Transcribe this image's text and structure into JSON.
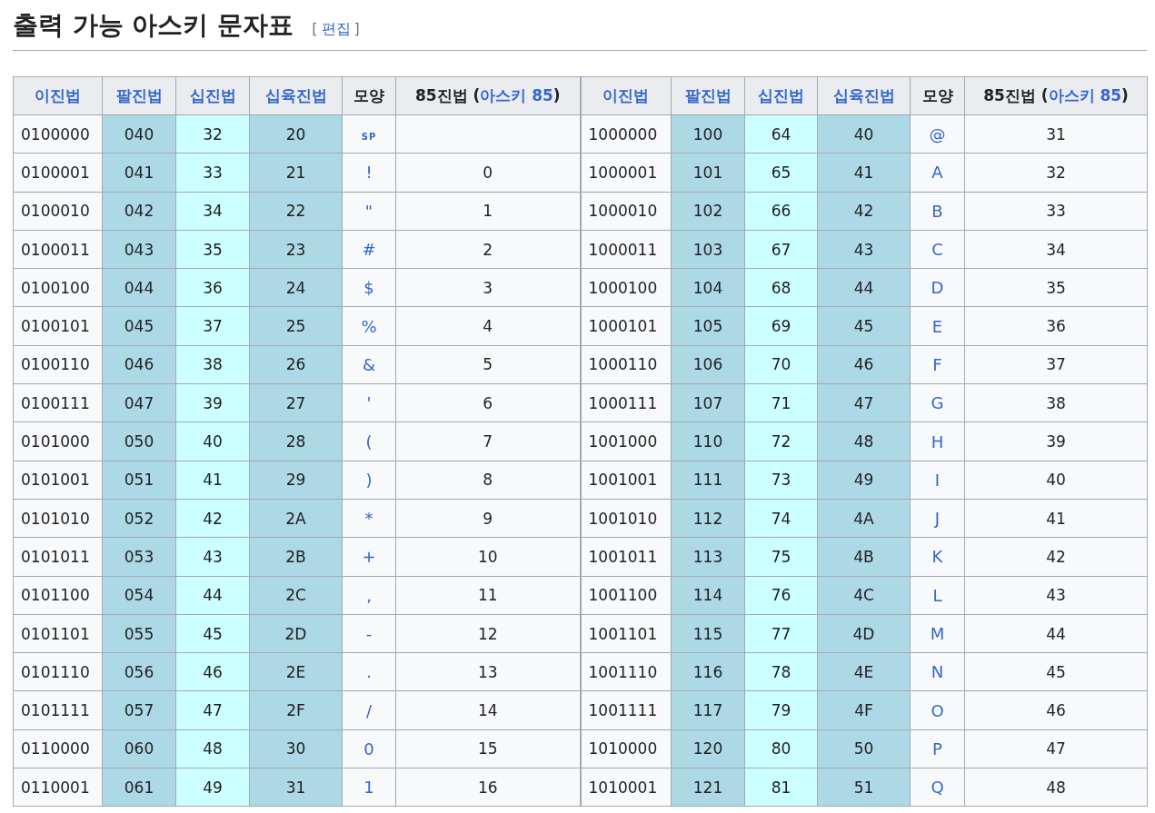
{
  "heading": {
    "title": "출력 가능 아스키 문자표",
    "edit": {
      "open": "[",
      "label": "편집",
      "close": "]"
    }
  },
  "table": {
    "columns": [
      {
        "parts": [
          {
            "text": "이진법",
            "link": true
          }
        ],
        "kind": "text"
      },
      {
        "parts": [
          {
            "text": "팔진법",
            "link": true
          }
        ],
        "kind": "text",
        "color": "#add8e6"
      },
      {
        "parts": [
          {
            "text": "십진법",
            "link": true
          }
        ],
        "kind": "text",
        "color": "#ccffff"
      },
      {
        "parts": [
          {
            "text": "십육진법",
            "link": true
          }
        ],
        "kind": "text",
        "color": "#add8e6"
      },
      {
        "parts": [
          {
            "text": "모양",
            "link": false
          }
        ],
        "kind": "glyph"
      },
      {
        "parts": [
          {
            "text": "85진법 (",
            "link": false
          },
          {
            "text": "아스키 85",
            "link": true
          },
          {
            "text": ")",
            "link": false
          }
        ],
        "kind": "text"
      },
      {
        "parts": [
          {
            "text": "이진법",
            "link": true
          }
        ],
        "kind": "text"
      },
      {
        "parts": [
          {
            "text": "팔진법",
            "link": true
          }
        ],
        "kind": "text",
        "color": "#add8e6"
      },
      {
        "parts": [
          {
            "text": "십진법",
            "link": true
          }
        ],
        "kind": "text",
        "color": "#ccffff"
      },
      {
        "parts": [
          {
            "text": "십육진법",
            "link": true
          }
        ],
        "kind": "text",
        "color": "#add8e6"
      },
      {
        "parts": [
          {
            "text": "모양",
            "link": false
          }
        ],
        "kind": "glyph"
      },
      {
        "parts": [
          {
            "text": "85진법 (",
            "link": false
          },
          {
            "text": "아스키 85",
            "link": true
          },
          {
            "text": ")",
            "link": false
          }
        ],
        "kind": "text"
      }
    ],
    "rows": [
      [
        "0100000",
        "040",
        "32",
        "20",
        {
          "text": "SP",
          "small": true
        },
        null,
        "1000000",
        "100",
        "64",
        "40",
        "@",
        "31"
      ],
      [
        "0100001",
        "041",
        "33",
        "21",
        "!",
        "0",
        "1000001",
        "101",
        "65",
        "41",
        "A",
        "32"
      ],
      [
        "0100010",
        "042",
        "34",
        "22",
        "\"",
        "1",
        "1000010",
        "102",
        "66",
        "42",
        "B",
        "33"
      ],
      [
        "0100011",
        "043",
        "35",
        "23",
        "#",
        "2",
        "1000011",
        "103",
        "67",
        "43",
        "C",
        "34"
      ],
      [
        "0100100",
        "044",
        "36",
        "24",
        "$",
        "3",
        "1000100",
        "104",
        "68",
        "44",
        "D",
        "35"
      ],
      [
        "0100101",
        "045",
        "37",
        "25",
        "%",
        "4",
        "1000101",
        "105",
        "69",
        "45",
        "E",
        "36"
      ],
      [
        "0100110",
        "046",
        "38",
        "26",
        "&",
        "5",
        "1000110",
        "106",
        "70",
        "46",
        "F",
        "37"
      ],
      [
        "0100111",
        "047",
        "39",
        "27",
        "'",
        "6",
        "1000111",
        "107",
        "71",
        "47",
        "G",
        "38"
      ],
      [
        "0101000",
        "050",
        "40",
        "28",
        "(",
        "7",
        "1001000",
        "110",
        "72",
        "48",
        "H",
        "39"
      ],
      [
        "0101001",
        "051",
        "41",
        "29",
        ")",
        "8",
        "1001001",
        "111",
        "73",
        "49",
        "I",
        "40"
      ],
      [
        "0101010",
        "052",
        "42",
        "2A",
        "*",
        "9",
        "1001010",
        "112",
        "74",
        "4A",
        "J",
        "41"
      ],
      [
        "0101011",
        "053",
        "43",
        "2B",
        "+",
        "10",
        "1001011",
        "113",
        "75",
        "4B",
        "K",
        "42"
      ],
      [
        "0101100",
        "054",
        "44",
        "2C",
        ",",
        "11",
        "1001100",
        "114",
        "76",
        "4C",
        "L",
        "43"
      ],
      [
        "0101101",
        "055",
        "45",
        "2D",
        "-",
        "12",
        "1001101",
        "115",
        "77",
        "4D",
        "M",
        "44"
      ],
      [
        "0101110",
        "056",
        "46",
        "2E",
        ".",
        "13",
        "1001110",
        "116",
        "78",
        "4E",
        "N",
        "45"
      ],
      [
        "0101111",
        "057",
        "47",
        "2F",
        "/",
        "14",
        "1001111",
        "117",
        "79",
        "4F",
        "O",
        "46"
      ],
      [
        "0110000",
        "060",
        "48",
        "30",
        "0",
        "15",
        "1010000",
        "120",
        "80",
        "50",
        "P",
        "47"
      ],
      [
        "0110001",
        "061",
        "49",
        "31",
        "1",
        "16",
        "1010001",
        "121",
        "81",
        "51",
        "Q",
        "48"
      ]
    ]
  }
}
